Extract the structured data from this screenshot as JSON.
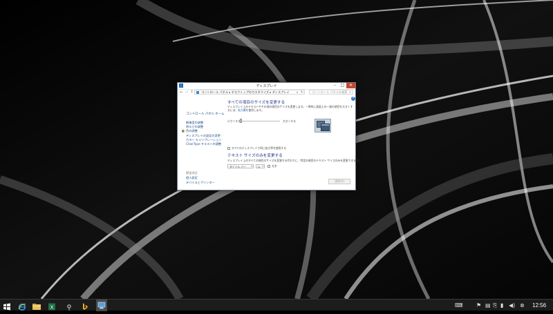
{
  "window": {
    "title": "ディスプレイ",
    "minimize_icon": "minimize-icon",
    "maximize_icon": "maximize-icon",
    "close_icon": "close-icon"
  },
  "addressbar": {
    "breadcrumb": "コントロール パネル ▸ デスクトップのカスタマイズ ▸ ディスプレイ",
    "search_placeholder": "コントロール パネルの検索"
  },
  "sidebar": {
    "home": "コントロール パネル ホーム",
    "links": [
      "解像度の調整",
      "明るさの調整",
      "色の調整",
      "ディスプレイの設定の変更",
      "カラー キャリブレーション",
      "ClearType テキストの調整"
    ],
    "see_also_label": "関連項目",
    "see_also_links": [
      "個人設定",
      "デバイスとプリンター"
    ]
  },
  "main": {
    "heading1": "すべての項目のサイズを変更する",
    "desc1": "ディスプレイ上のテキストやその他の項目のサイズを変更します。一時的に画面上の一部の項目を大きくするには、",
    "desc1_link": "拡大鏡",
    "desc1_tail": "を使用します。",
    "slider_small": "小さくする",
    "slider_large": "大きくする",
    "slider_value_percent": 0,
    "multi_checkbox_label": "すべてのディスプレイで同じ拡大率を使用する",
    "heading2": "テキスト サイズのみを変更する",
    "desc2": "ディスプレイ上のすべての項目のサイズを変更する代わりに、特定の項目のテキスト サイズのみを変更できます。",
    "item_select_value": "タイトル バー",
    "size_select_value": "11",
    "bold_label": "太字",
    "apply_label": "適用(A)"
  },
  "taskbar": {
    "clock": "12:56"
  },
  "colors": {
    "heading": "#1e3287",
    "link": "#1d4d84",
    "taskbar": "#1c1c1c"
  }
}
